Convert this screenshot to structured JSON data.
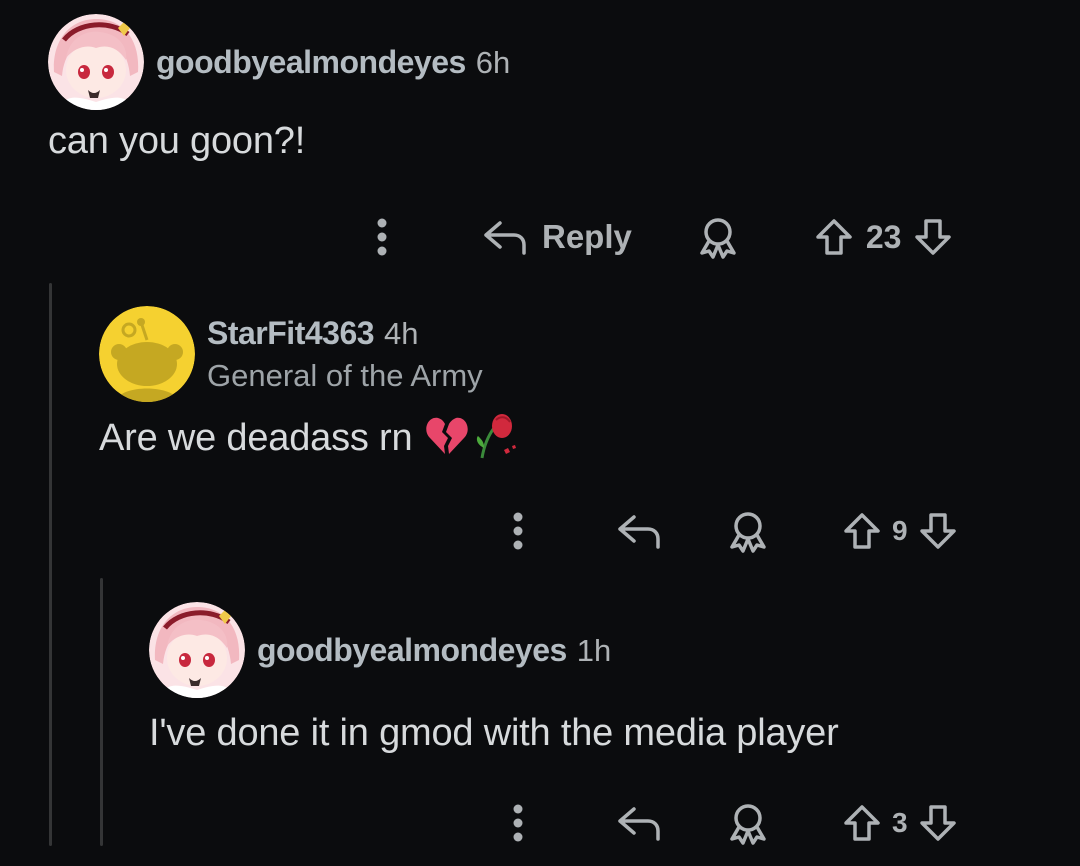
{
  "comments": [
    {
      "username": "goodbyealmondeyes",
      "time": "6h",
      "body": "can you goon?!",
      "reply_label": "Reply",
      "votes": "23",
      "avatar_icon": "anime-avatar-icon"
    },
    {
      "username": "StarFit4363",
      "time": "4h",
      "flair": "General of the Army",
      "body": "Are we deadass rn",
      "emojis": [
        "broken-heart-icon",
        "wilted-rose-icon"
      ],
      "votes": "9",
      "avatar_icon": "default-snoo-avatar-icon"
    },
    {
      "username": "goodbyealmondeyes",
      "time": "1h",
      "body": "I've done it in gmod with the media player",
      "votes": "3",
      "avatar_icon": "anime-avatar-icon"
    }
  ],
  "colors": {
    "background": "#0b0c0e",
    "text": "#d7dadc",
    "muted": "#aeb2b5",
    "thread_line": "#343536",
    "snoo_avatar_bg": "#f5d130"
  }
}
